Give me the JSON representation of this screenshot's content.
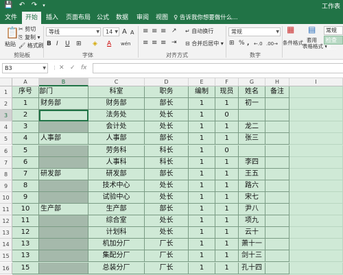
{
  "titlebar": {
    "window_title": "工作表",
    "qa_save": "💾",
    "qa_undo": "↶",
    "qa_redo": "↷"
  },
  "tabs": [
    {
      "label": "文件"
    },
    {
      "label": "开始",
      "active": true
    },
    {
      "label": "插入"
    },
    {
      "label": "页面布局"
    },
    {
      "label": "公式"
    },
    {
      "label": "数据"
    },
    {
      "label": "审阅"
    },
    {
      "label": "视图"
    }
  ],
  "tell_me": "♀ 告诉我你想要做什么...",
  "ribbon": {
    "paste": "粘贴",
    "cut": "✂ 剪切",
    "copy": "⎘ 复制 ▾",
    "format_painter": "🖌 格式刷",
    "clipboard_group": "剪贴板",
    "font_name": "等线",
    "font_size": "14",
    "grow_font": "A",
    "shrink_font": "A",
    "bold": "B",
    "italic": "I",
    "underline": "U",
    "border": "⊞",
    "fill": "◈",
    "font_color": "A",
    "phonetic": "wén",
    "font_group": "字体",
    "wrap_text": "自动换行",
    "merge_center": "合并后居中 ▾",
    "alignment_group": "对齐方式",
    "number_format": "常规",
    "percent": "%",
    "comma": ",",
    "inc_decimal": "←.0",
    "dec_decimal": ".00→",
    "number_group": "数字",
    "conditional_format": "条件格式",
    "table_format_1": "套用",
    "table_format_2": "表格格式 ▾",
    "style_normal": "常规",
    "style_check": "检查单..."
  },
  "formula_bar": {
    "name_box": "B3",
    "fx": "fx",
    "cancel": "✕",
    "enter": "✓",
    "value": ""
  },
  "columns": [
    "A",
    "B",
    "C",
    "D",
    "E",
    "F",
    "G",
    "H",
    "I"
  ],
  "selected_column": "B",
  "selected_row": "3",
  "rows": [
    {
      "num": "1",
      "cells": [
        "序号",
        "部门",
        "科室",
        "职务",
        "编制",
        "现员",
        "姓名",
        "备注"
      ]
    },
    {
      "num": "2",
      "cells": [
        "1",
        "财务部",
        "财务部",
        "部长",
        "1",
        "1",
        "初一",
        ""
      ]
    },
    {
      "num": "3",
      "cells": [
        "2",
        "",
        "法务处",
        "处长",
        "1",
        "0",
        "",
        ""
      ]
    },
    {
      "num": "4",
      "cells": [
        "3",
        "",
        "会计处",
        "处长",
        "1",
        "1",
        "龙二",
        ""
      ]
    },
    {
      "num": "5",
      "cells": [
        "4",
        "人事部",
        "人事部",
        "部长",
        "1",
        "1",
        "张三",
        ""
      ]
    },
    {
      "num": "6",
      "cells": [
        "5",
        "",
        "劳务科",
        "科长",
        "1",
        "0",
        "",
        ""
      ]
    },
    {
      "num": "7",
      "cells": [
        "6",
        "",
        "人事科",
        "科长",
        "1",
        "1",
        "李四",
        ""
      ]
    },
    {
      "num": "8",
      "cells": [
        "7",
        "研发部",
        "研发部",
        "部长",
        "1",
        "1",
        "王五",
        ""
      ]
    },
    {
      "num": "9",
      "cells": [
        "8",
        "",
        "技术中心",
        "处长",
        "1",
        "1",
        "路六",
        ""
      ]
    },
    {
      "num": "10",
      "cells": [
        "9",
        "",
        "试验中心",
        "处长",
        "1",
        "1",
        "宋七",
        ""
      ]
    },
    {
      "num": "11",
      "cells": [
        "10",
        "生产部",
        "生产部",
        "部长",
        "1",
        "1",
        "尹八",
        ""
      ]
    },
    {
      "num": "12",
      "cells": [
        "11",
        "",
        "综合室",
        "处长",
        "1",
        "1",
        "项九",
        ""
      ]
    },
    {
      "num": "13",
      "cells": [
        "12",
        "",
        "计划科",
        "处长",
        "1",
        "1",
        "云十",
        ""
      ]
    },
    {
      "num": "14",
      "cells": [
        "13",
        "",
        "机加分厂",
        "厂长",
        "1",
        "1",
        "萧十一",
        ""
      ]
    },
    {
      "num": "15",
      "cells": [
        "13",
        "",
        "集配分厂",
        "厂长",
        "1",
        "1",
        "剑十三",
        ""
      ]
    },
    {
      "num": "16",
      "cells": [
        "15",
        "",
        "总装分厂",
        "厂长",
        "1",
        "1",
        "孔十四",
        ""
      ]
    }
  ],
  "colors": {
    "excel_green": "#217346",
    "sheet_fill": "#cfe9d6",
    "merged_fill": "#a5b9ab"
  }
}
